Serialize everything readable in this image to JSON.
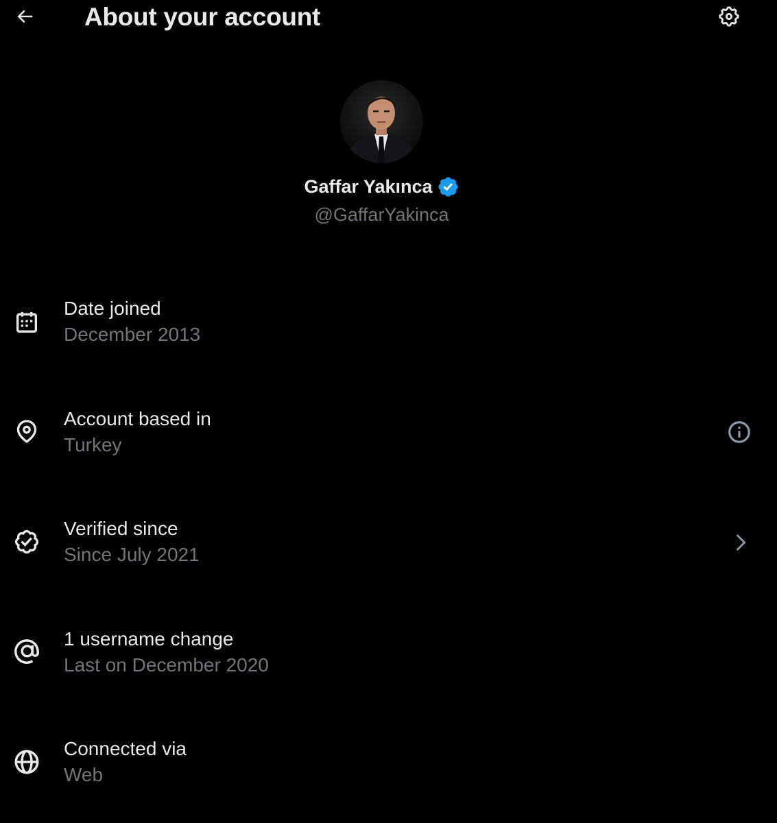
{
  "header": {
    "title": "About your account",
    "back_icon": "arrow-left-icon",
    "settings_icon": "gear-icon"
  },
  "profile": {
    "name": "Gaffar Yakınca",
    "handle": "@GaffarYakinca",
    "verified": true,
    "verified_color": "#1d9bf0",
    "avatar_icon": "profile-photo"
  },
  "rows": [
    {
      "label": "Date joined",
      "value": "December 2013",
      "icon": "calendar-icon"
    },
    {
      "label": "Account based in",
      "value": "Turkey",
      "icon": "location-pin-icon",
      "action_icon": "info-icon"
    },
    {
      "label": "Verified since",
      "value": "Since July 2021",
      "icon": "verified-check-icon",
      "action_icon": "chevron-right-icon"
    },
    {
      "label": "1 username change",
      "value": "Last on December 2020",
      "icon": "at-sign-icon"
    },
    {
      "label": "Connected via",
      "value": "Web",
      "icon": "globe-icon"
    }
  ],
  "colors": {
    "background": "#000000",
    "primary_text": "#e7e9ea",
    "secondary_text": "#71767b",
    "accent": "#1d9bf0"
  }
}
